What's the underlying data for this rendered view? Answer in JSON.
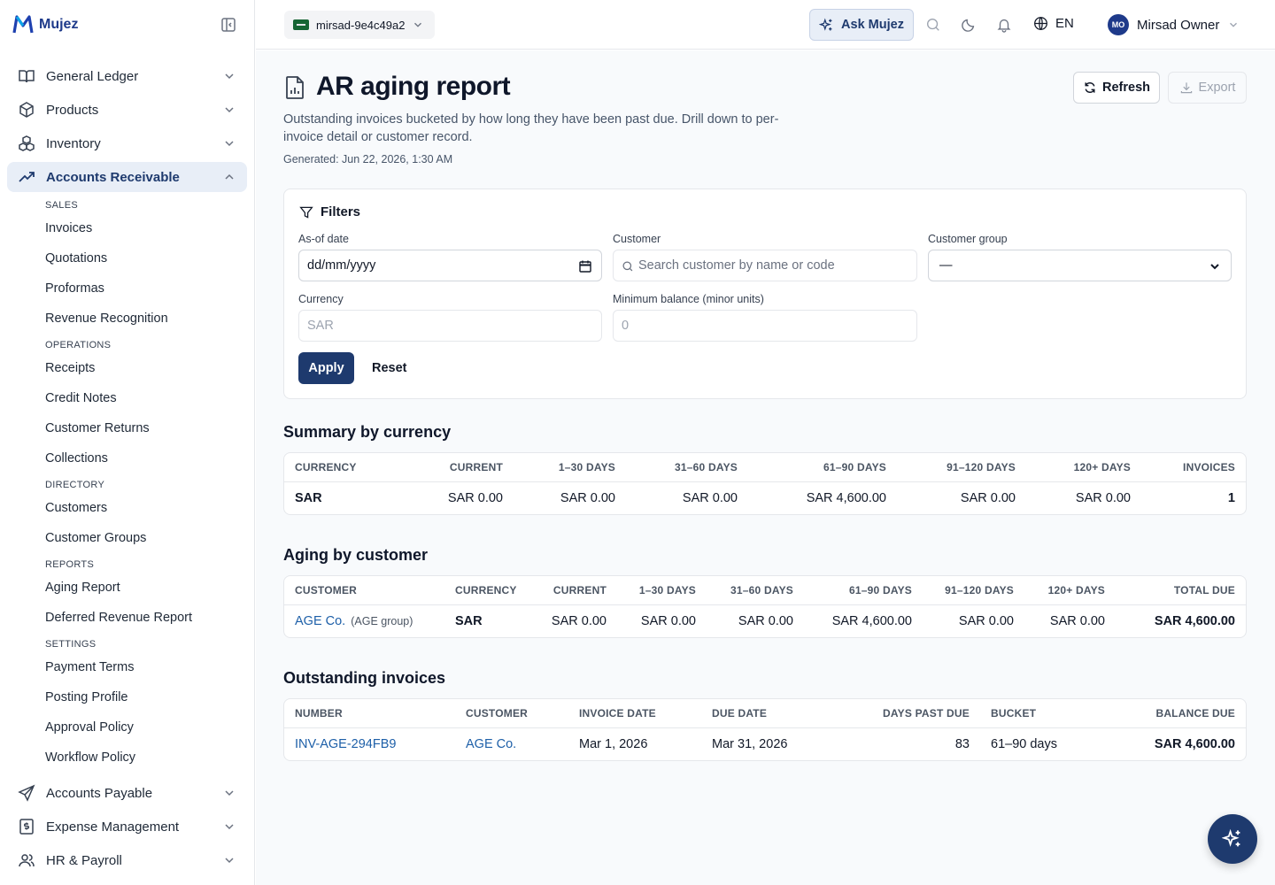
{
  "brand": {
    "name": "Mujez",
    "accent": "#1e3a6e"
  },
  "sidebar": {
    "top_items": [
      {
        "label": "General Ledger",
        "icon": "book-open-icon"
      },
      {
        "label": "Products",
        "icon": "box-icon"
      },
      {
        "label": "Inventory",
        "icon": "boxes-icon"
      },
      {
        "label": "Accounts Receivable",
        "icon": "trending-up-icon",
        "active": true
      }
    ],
    "sections": [
      {
        "label": "SALES",
        "items": [
          "Invoices",
          "Quotations",
          "Proformas",
          "Revenue Recognition"
        ]
      },
      {
        "label": "OPERATIONS",
        "items": [
          "Receipts",
          "Credit Notes",
          "Customer Returns",
          "Collections"
        ]
      },
      {
        "label": "DIRECTORY",
        "items": [
          "Customers",
          "Customer Groups"
        ]
      },
      {
        "label": "REPORTS",
        "items": [
          "Aging Report",
          "Deferred Revenue Report"
        ]
      },
      {
        "label": "SETTINGS",
        "items": [
          "Payment Terms",
          "Posting Profile",
          "Approval Policy",
          "Workflow Policy"
        ]
      }
    ],
    "bottom_items": [
      {
        "label": "Accounts Payable",
        "icon": "send-icon"
      },
      {
        "label": "Expense Management",
        "icon": "receipt-dollar-icon"
      },
      {
        "label": "HR & Payroll",
        "icon": "users-icon"
      }
    ]
  },
  "topbar": {
    "tenant": "mirsad-9e4c49a2",
    "ask_label": "Ask Mujez",
    "language": "EN",
    "user_initials": "MO",
    "user_name": "Mirsad Owner"
  },
  "page": {
    "title": "AR aging report",
    "description": "Outstanding invoices bucketed by how long they have been past due. Drill down to per-invoice detail or customer record.",
    "generated": "Generated: Jun 22, 2026, 1:30 AM",
    "refresh_label": "Refresh",
    "export_label": "Export"
  },
  "filters": {
    "title": "Filters",
    "as_of_label": "As-of date",
    "as_of_value": "dd/mm/yyyy",
    "customer_label": "Customer",
    "customer_placeholder": "Search customer by name or code",
    "group_label": "Customer group",
    "group_value": "—",
    "currency_label": "Currency",
    "currency_value": "SAR",
    "min_balance_label": "Minimum balance (minor units)",
    "min_balance_value": "0",
    "apply_label": "Apply",
    "reset_label": "Reset"
  },
  "summary": {
    "title": "Summary by currency",
    "headers": [
      "CURRENCY",
      "CURRENT",
      "1–30 DAYS",
      "31–60 DAYS",
      "61–90 DAYS",
      "91–120 DAYS",
      "120+ DAYS",
      "INVOICES"
    ],
    "rows": [
      [
        "SAR",
        "SAR 0.00",
        "SAR 0.00",
        "SAR 0.00",
        "SAR 4,600.00",
        "SAR 0.00",
        "SAR 0.00",
        "1"
      ]
    ]
  },
  "by_customer": {
    "title": "Aging by customer",
    "headers": [
      "CUSTOMER",
      "CURRENCY",
      "CURRENT",
      "1–30 DAYS",
      "31–60 DAYS",
      "61–90 DAYS",
      "91–120 DAYS",
      "120+ DAYS",
      "TOTAL DUE"
    ],
    "rows": [
      {
        "customer": "AGE Co.",
        "group": "(AGE group)",
        "currency": "SAR",
        "current": "SAR 0.00",
        "d1_30": "SAR 0.00",
        "d31_60": "SAR 0.00",
        "d61_90": "SAR 4,600.00",
        "d91_120": "SAR 0.00",
        "d120p": "SAR 0.00",
        "total": "SAR 4,600.00"
      }
    ]
  },
  "invoices": {
    "title": "Outstanding invoices",
    "headers": [
      "NUMBER",
      "CUSTOMER",
      "INVOICE DATE",
      "DUE DATE",
      "DAYS PAST DUE",
      "BUCKET",
      "BALANCE DUE"
    ],
    "rows": [
      {
        "number": "INV-AGE-294FB9",
        "customer": "AGE Co.",
        "invoice_date": "Mar 1, 2026",
        "due_date": "Mar 31, 2026",
        "days_past_due": "83",
        "bucket": "61–90 days",
        "balance": "SAR 4,600.00"
      }
    ]
  }
}
